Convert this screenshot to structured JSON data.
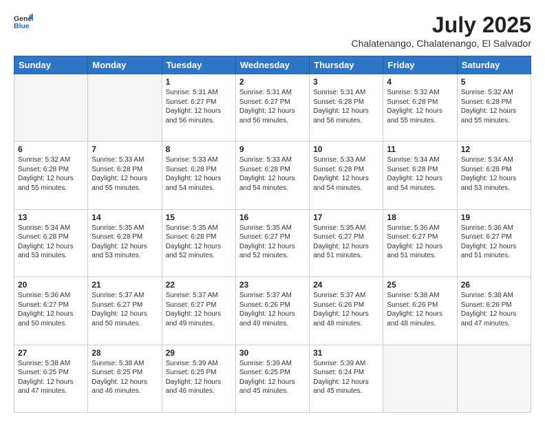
{
  "logo": {
    "line1": "General",
    "line2": "Blue"
  },
  "title": "July 2025",
  "subtitle": "Chalatenango, Chalatenango, El Salvador",
  "weekdays": [
    "Sunday",
    "Monday",
    "Tuesday",
    "Wednesday",
    "Thursday",
    "Friday",
    "Saturday"
  ],
  "weeks": [
    [
      {
        "day": "",
        "info": ""
      },
      {
        "day": "",
        "info": ""
      },
      {
        "day": "1",
        "info": "Sunrise: 5:31 AM\nSunset: 6:27 PM\nDaylight: 12 hours and 56 minutes."
      },
      {
        "day": "2",
        "info": "Sunrise: 5:31 AM\nSunset: 6:27 PM\nDaylight: 12 hours and 56 minutes."
      },
      {
        "day": "3",
        "info": "Sunrise: 5:31 AM\nSunset: 6:28 PM\nDaylight: 12 hours and 56 minutes."
      },
      {
        "day": "4",
        "info": "Sunrise: 5:32 AM\nSunset: 6:28 PM\nDaylight: 12 hours and 55 minutes."
      },
      {
        "day": "5",
        "info": "Sunrise: 5:32 AM\nSunset: 6:28 PM\nDaylight: 12 hours and 55 minutes."
      }
    ],
    [
      {
        "day": "6",
        "info": "Sunrise: 5:32 AM\nSunset: 6:28 PM\nDaylight: 12 hours and 55 minutes."
      },
      {
        "day": "7",
        "info": "Sunrise: 5:33 AM\nSunset: 6:28 PM\nDaylight: 12 hours and 55 minutes."
      },
      {
        "day": "8",
        "info": "Sunrise: 5:33 AM\nSunset: 6:28 PM\nDaylight: 12 hours and 54 minutes."
      },
      {
        "day": "9",
        "info": "Sunrise: 5:33 AM\nSunset: 6:28 PM\nDaylight: 12 hours and 54 minutes."
      },
      {
        "day": "10",
        "info": "Sunrise: 5:33 AM\nSunset: 6:28 PM\nDaylight: 12 hours and 54 minutes."
      },
      {
        "day": "11",
        "info": "Sunrise: 5:34 AM\nSunset: 6:28 PM\nDaylight: 12 hours and 54 minutes."
      },
      {
        "day": "12",
        "info": "Sunrise: 5:34 AM\nSunset: 6:28 PM\nDaylight: 12 hours and 53 minutes."
      }
    ],
    [
      {
        "day": "13",
        "info": "Sunrise: 5:34 AM\nSunset: 6:28 PM\nDaylight: 12 hours and 53 minutes."
      },
      {
        "day": "14",
        "info": "Sunrise: 5:35 AM\nSunset: 6:28 PM\nDaylight: 12 hours and 53 minutes."
      },
      {
        "day": "15",
        "info": "Sunrise: 5:35 AM\nSunset: 6:28 PM\nDaylight: 12 hours and 52 minutes."
      },
      {
        "day": "16",
        "info": "Sunrise: 5:35 AM\nSunset: 6:27 PM\nDaylight: 12 hours and 52 minutes."
      },
      {
        "day": "17",
        "info": "Sunrise: 5:35 AM\nSunset: 6:27 PM\nDaylight: 12 hours and 51 minutes."
      },
      {
        "day": "18",
        "info": "Sunrise: 5:36 AM\nSunset: 6:27 PM\nDaylight: 12 hours and 51 minutes."
      },
      {
        "day": "19",
        "info": "Sunrise: 5:36 AM\nSunset: 6:27 PM\nDaylight: 12 hours and 51 minutes."
      }
    ],
    [
      {
        "day": "20",
        "info": "Sunrise: 5:36 AM\nSunset: 6:27 PM\nDaylight: 12 hours and 50 minutes."
      },
      {
        "day": "21",
        "info": "Sunrise: 5:37 AM\nSunset: 6:27 PM\nDaylight: 12 hours and 50 minutes."
      },
      {
        "day": "22",
        "info": "Sunrise: 5:37 AM\nSunset: 6:27 PM\nDaylight: 12 hours and 49 minutes."
      },
      {
        "day": "23",
        "info": "Sunrise: 5:37 AM\nSunset: 6:26 PM\nDaylight: 12 hours and 49 minutes."
      },
      {
        "day": "24",
        "info": "Sunrise: 5:37 AM\nSunset: 6:26 PM\nDaylight: 12 hours and 48 minutes."
      },
      {
        "day": "25",
        "info": "Sunrise: 5:38 AM\nSunset: 6:26 PM\nDaylight: 12 hours and 48 minutes."
      },
      {
        "day": "26",
        "info": "Sunrise: 5:38 AM\nSunset: 6:26 PM\nDaylight: 12 hours and 47 minutes."
      }
    ],
    [
      {
        "day": "27",
        "info": "Sunrise: 5:38 AM\nSunset: 6:25 PM\nDaylight: 12 hours and 47 minutes."
      },
      {
        "day": "28",
        "info": "Sunrise: 5:38 AM\nSunset: 6:25 PM\nDaylight: 12 hours and 46 minutes."
      },
      {
        "day": "29",
        "info": "Sunrise: 5:39 AM\nSunset: 6:25 PM\nDaylight: 12 hours and 46 minutes."
      },
      {
        "day": "30",
        "info": "Sunrise: 5:39 AM\nSunset: 6:25 PM\nDaylight: 12 hours and 45 minutes."
      },
      {
        "day": "31",
        "info": "Sunrise: 5:39 AM\nSunset: 6:24 PM\nDaylight: 12 hours and 45 minutes."
      },
      {
        "day": "",
        "info": ""
      },
      {
        "day": "",
        "info": ""
      }
    ]
  ]
}
